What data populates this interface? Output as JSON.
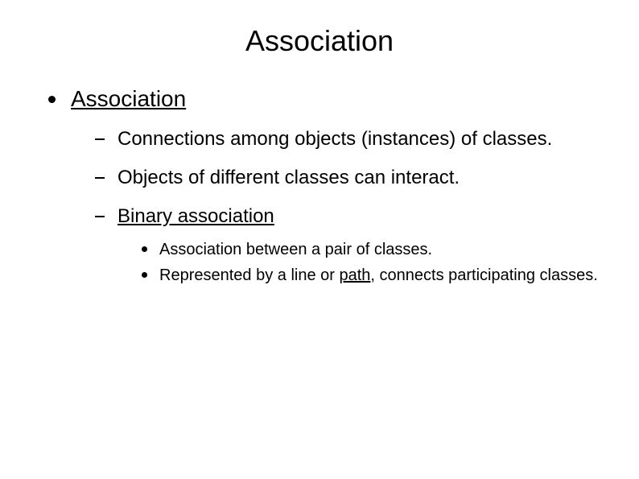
{
  "title": "Association",
  "level1": {
    "label": "Association",
    "items": [
      {
        "text": "Connections among objects (instances) of classes."
      },
      {
        "text": "Objects of different classes can interact."
      },
      {
        "text": "Binary association",
        "underline": true,
        "sub": [
          {
            "text": "Association between a pair of classes."
          },
          {
            "prefix": "Represented by a line or ",
            "underlined": "path",
            "suffix": ", connects participating classes."
          }
        ]
      }
    ]
  }
}
